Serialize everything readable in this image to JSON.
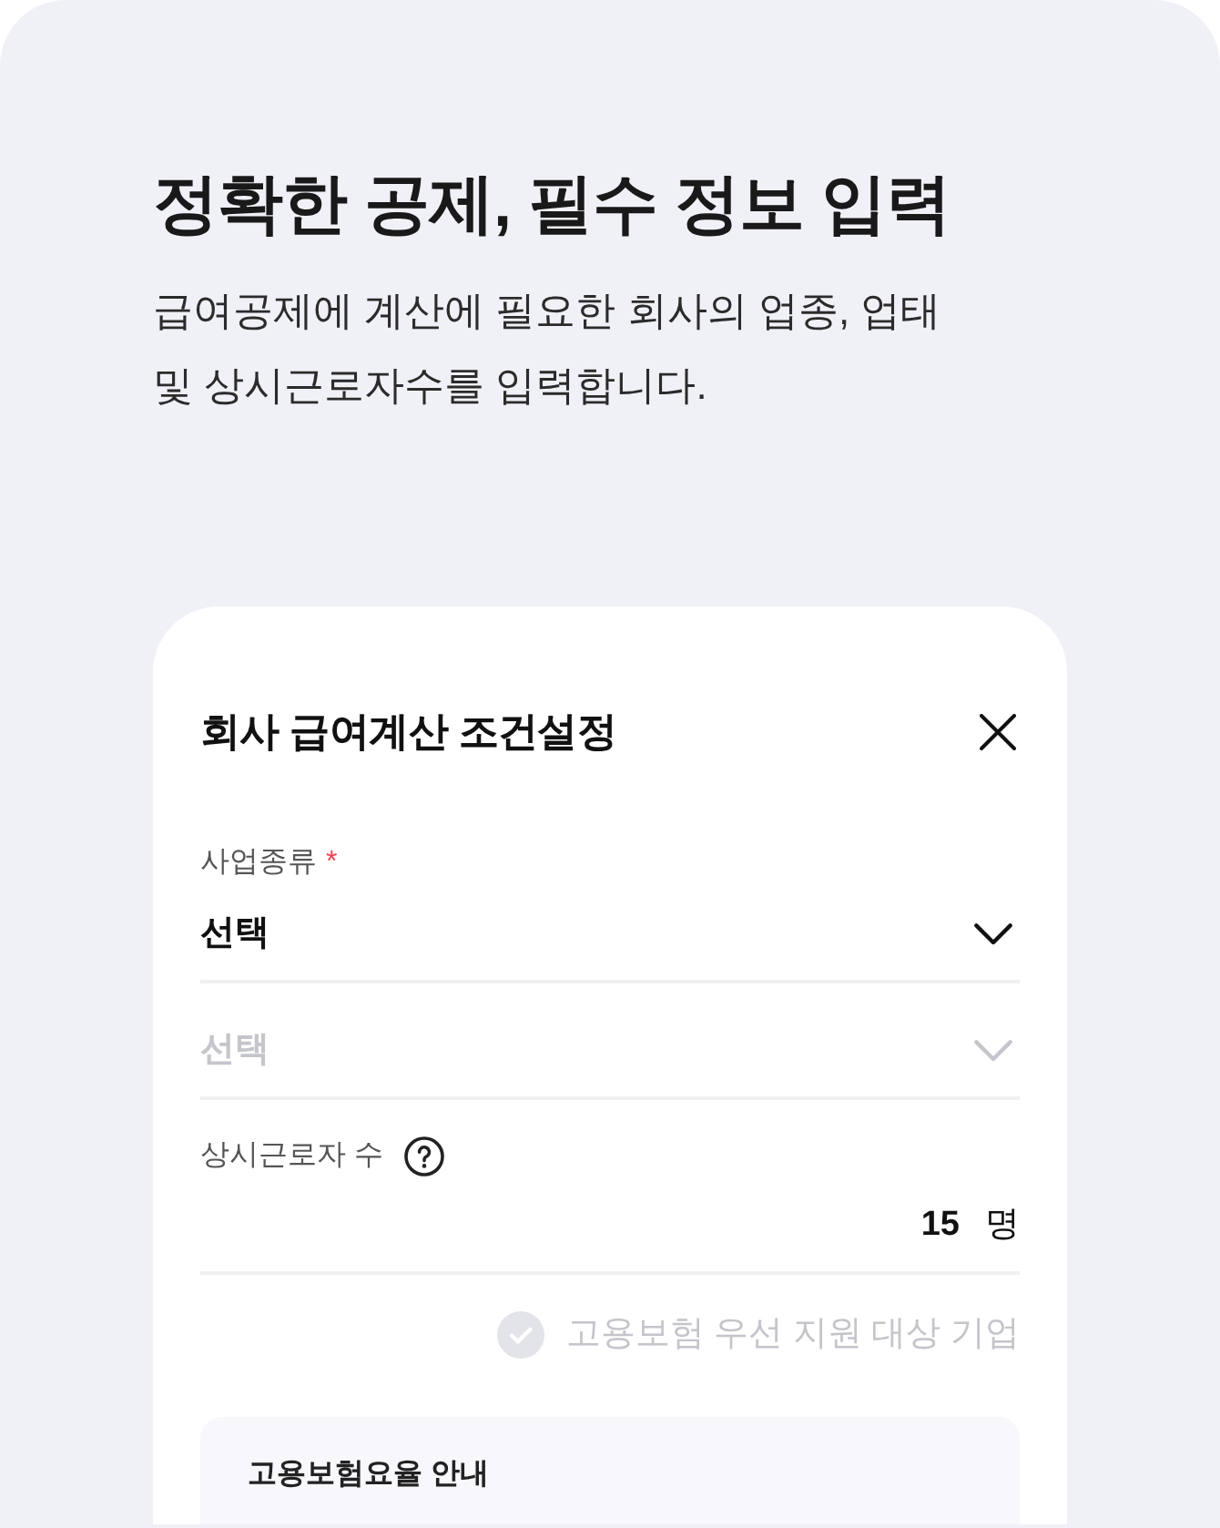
{
  "page": {
    "title": "정확한 공제, 필수 정보 입력",
    "description_lines": [
      "급여공제에 계산에 필요한 회사의 업종, 업태",
      "및 상시근로자수를 입력합니다."
    ]
  },
  "dialog": {
    "title": "회사 급여계산 조건설정",
    "fields": [
      {
        "kind": "select",
        "label": "사업종류",
        "required_mark": "*",
        "value": "선택",
        "disabled": false
      },
      {
        "kind": "select",
        "placeholder": "선택",
        "disabled": true
      },
      {
        "kind": "number",
        "label": "상시근로자 수",
        "help": true,
        "value": "15",
        "unit": "명"
      }
    ],
    "checkbox": {
      "label": "고용보험 우선 지원 대상 기업",
      "checked": false
    },
    "info_box": {
      "title": "고용보험요율 안내"
    }
  }
}
